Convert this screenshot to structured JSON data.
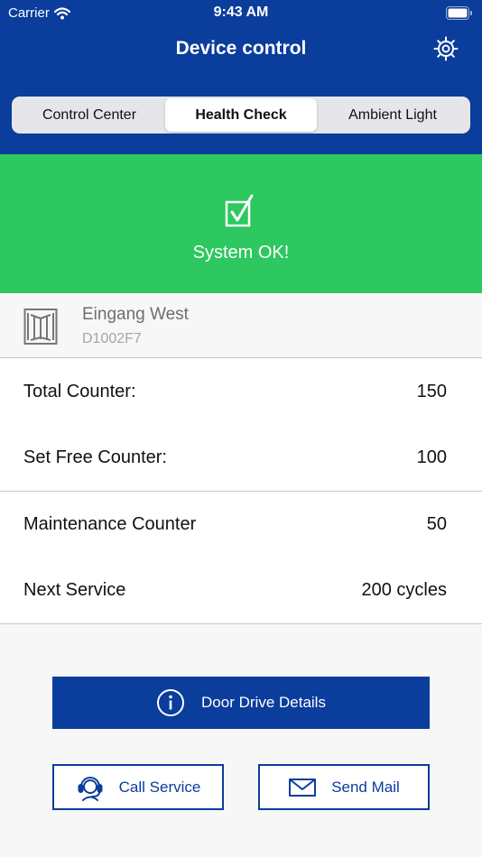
{
  "status_bar": {
    "carrier": "Carrier",
    "time": "9:43 AM"
  },
  "header": {
    "title": "Device control"
  },
  "tabs": [
    {
      "label": "Control Center"
    },
    {
      "label": "Health Check"
    },
    {
      "label": "Ambient Light"
    }
  ],
  "system_status": {
    "text": "System OK!"
  },
  "device": {
    "name": "Eingang West",
    "id": "D1002F7"
  },
  "counters": [
    {
      "label": "Total Counter:",
      "value": "150"
    },
    {
      "label": "Set Free Counter:",
      "value": "100"
    },
    {
      "label": "Maintenance Counter",
      "value": "50"
    },
    {
      "label": "Next Service",
      "value": "200 cycles"
    }
  ],
  "buttons": {
    "door_drive_details": "Door Drive Details",
    "call_service": "Call Service",
    "send_mail": "Send Mail"
  },
  "colors": {
    "brand_blue": "#0a3d9c",
    "status_green": "#2dc85f",
    "background": "#f7f7f7"
  }
}
